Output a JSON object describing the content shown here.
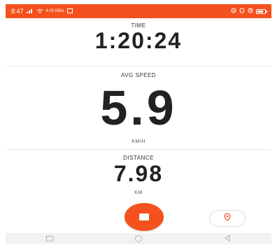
{
  "status_bar": {
    "time": "8:47",
    "left_icons": [
      "signal-icon",
      "wifi-icon",
      "data-speed-icon",
      "notification-icon"
    ],
    "right_icons": [
      "location-icon",
      "alarm-icon",
      "sync-icon",
      "battery-icon"
    ],
    "network_speed": "4.00 KB/s",
    "color": "#f4511e"
  },
  "workout": {
    "time_label": "TIME",
    "time_value": "1:20:24",
    "avg_speed_label": "AVG SPEED",
    "avg_speed_value": "5.9",
    "avg_speed_unit": "KM/H",
    "distance_label": "DISTANCE",
    "distance_value": "7.98",
    "distance_unit": "KM"
  },
  "controls": {
    "stop_icon": "stop-icon",
    "pin_icon": "location-pin-icon",
    "accent": "#f4511e"
  },
  "nav": {
    "icons": [
      "recent-apps-icon",
      "home-icon",
      "back-icon"
    ]
  }
}
